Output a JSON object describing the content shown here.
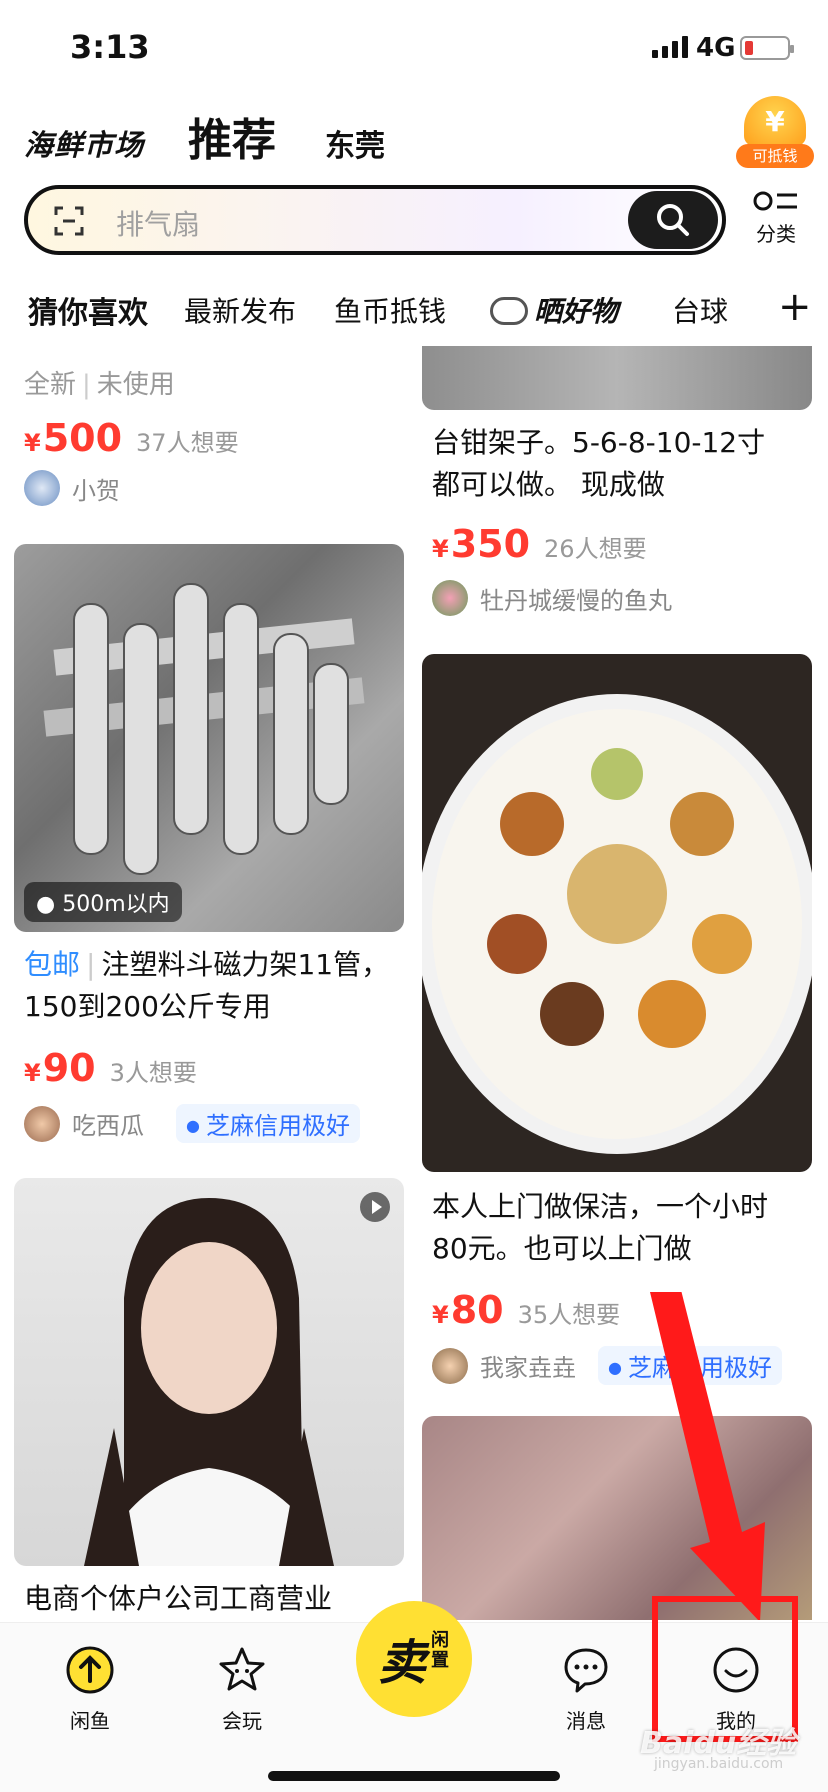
{
  "status_bar": {
    "time": "3:13",
    "network": "4G",
    "battery_level": 0.2
  },
  "header": {
    "logo": "海鲜市场",
    "tab_recommend": "推荐",
    "city": "东莞",
    "badge_label": "可抵钱",
    "badge_symbol": "¥"
  },
  "search": {
    "placeholder": "排气扇",
    "category_label": "分类"
  },
  "tabs": [
    "猜你喜欢",
    "最新发布",
    "鱼币抵钱",
    "晒好物",
    "台球"
  ],
  "feed": {
    "left": [
      {
        "condition": "全新",
        "condition2": "未使用",
        "price": "500",
        "want": "37人想要",
        "seller": "小贺"
      },
      {
        "location": "500m以内",
        "shipping": "包邮",
        "title": "注塑料斗磁力架11管，150到200公斤专用",
        "price": "90",
        "want": "3人想要",
        "seller": "吃西瓜",
        "credit": "芝麻信用极好"
      },
      {
        "title": "电商个体户公司工商营业"
      }
    ],
    "right": [
      {
        "title": "台钳架子。5-6-8-10-12寸 都可以做。  现成做",
        "price": "350",
        "want": "26人想要",
        "seller": "牡丹城缓慢的鱼丸"
      },
      {
        "title": "本人上门做保洁，一个小时80元。也可以上门做",
        "price": "80",
        "want": "35人想要",
        "seller": "我家垚垚",
        "credit": "芝麻信用极好"
      }
    ],
    "currency": "¥"
  },
  "bottom_nav": {
    "home": "闲鱼",
    "play": "会玩",
    "sell": "卖",
    "sell_sub": "闲置",
    "messages": "消息",
    "me": "我的"
  },
  "watermark": {
    "text": "Baidu经验",
    "sub": "jingyan.baidu.com"
  }
}
